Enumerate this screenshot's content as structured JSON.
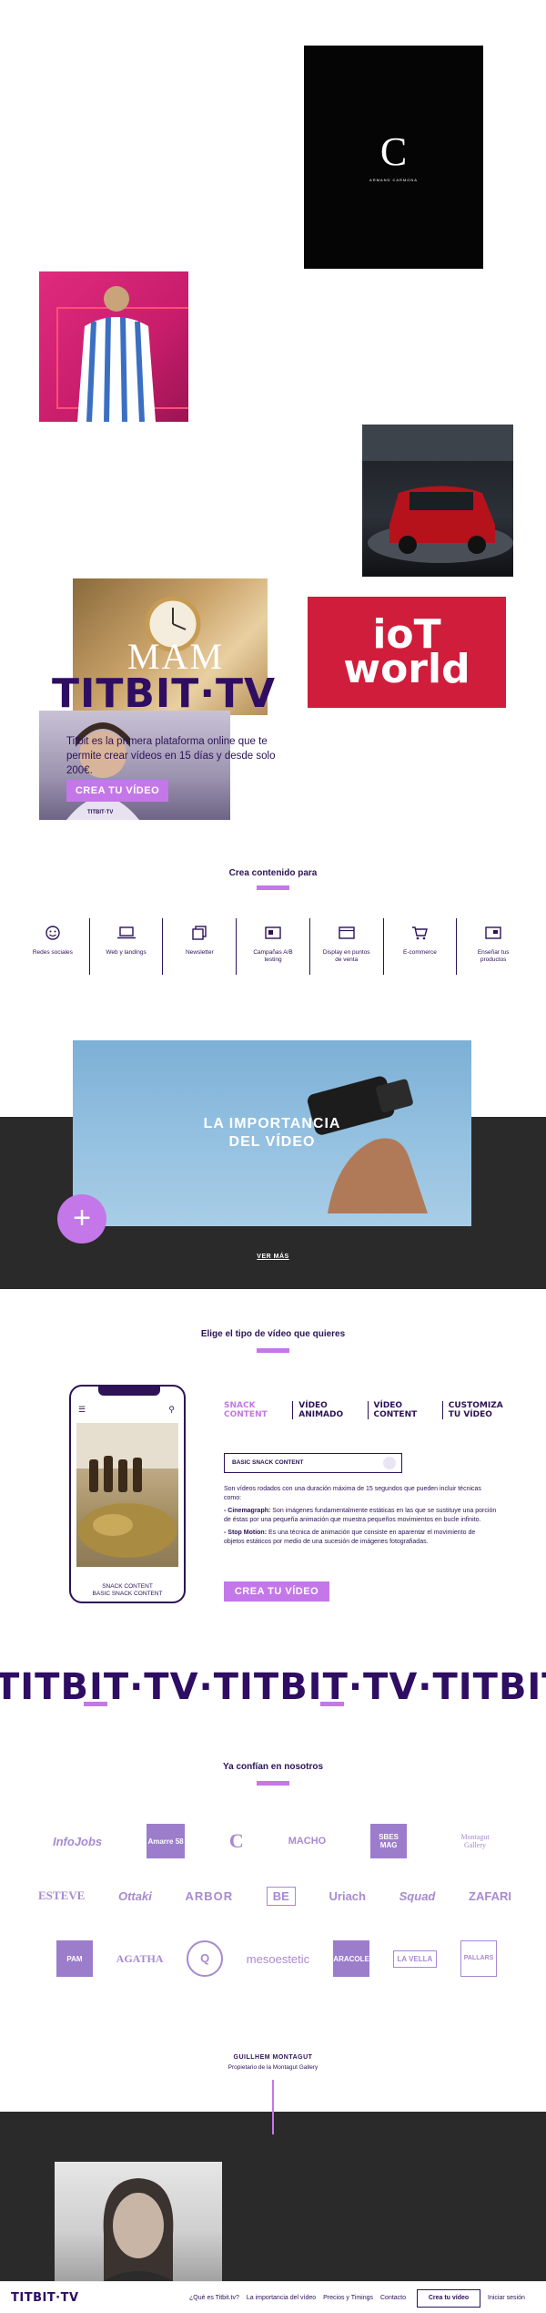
{
  "hero": {
    "tile_black_mark": "C",
    "tile_black_sub": "ARMAND CARMONA",
    "tile_iot": "ioT world",
    "tile_mam": "MAM",
    "brand": "TITBIT·TV",
    "text": "Titbit es la primera plataforma online que te permite crear vídeos en 15 días y desde solo 200€.",
    "cta": "CREA TU VÍDEO",
    "mini_brand": "TITBIT·TV"
  },
  "create_section": {
    "title": "Crea contenido para",
    "categories": [
      {
        "label": "Redes sociales",
        "icon": "smiley-icon"
      },
      {
        "label": "Web y landings",
        "icon": "laptop-icon"
      },
      {
        "label": "Newsletter",
        "icon": "newsletter-icon"
      },
      {
        "label": "Campañas A/B testing",
        "icon": "ab-test-icon"
      },
      {
        "label": "Display en puntos de venta",
        "icon": "display-icon"
      },
      {
        "label": "E-commerce",
        "icon": "cart-icon"
      },
      {
        "label": "Enseñar tus productos",
        "icon": "product-icon"
      }
    ]
  },
  "video_importance": {
    "title_line1": "LA IMPORTANCIA",
    "title_line2": "DEL VÍDEO",
    "plus": "+",
    "more": "VER MÁS"
  },
  "video_type": {
    "title": "Elige el tipo de vídeo que quieres",
    "tabs": [
      "SNACK CONTENT",
      "VÍDEO ANIMADO",
      "VÍDEO CONTENT",
      "CUSTOMIZA TU VÍDEO"
    ],
    "select_value": "BASIC SNACK CONTENT",
    "phone_caption_1": "SNACK CONTENT",
    "phone_caption_2": "BASIC SNACK CONTENT",
    "desc_intro": "Son vídeos rodados con una duración máxima de 15 segundos que pueden incluir técnicas como:",
    "desc_cine_label": "- Cinemagraph:",
    "desc_cine": "Son imágenes fundamentalmente estáticas en las que se sustituye una porción de éstas por una pequeña animación que muestra pequeños movimientos en bucle infinito.",
    "desc_stop_label": "- Stop Motion:",
    "desc_stop": "Es una técnica de animación que consiste en aparentar el movimiento de objetos estáticos por medio de una sucesión de imágenes fotografiadas.",
    "cta": "CREA TU VÍDEO"
  },
  "ticker": "TITBIT·TV·TITBIT·TV·TITBIT",
  "trust": {
    "title": "Ya confían en nosotros",
    "row1": [
      "InfoJobs",
      "Amarre 58",
      "C",
      "MACHO",
      "SBES MAG",
      "Montagut Gallery"
    ],
    "row2": [
      "ESTEVE",
      "Ottaki",
      "ARBOR",
      "BE",
      "Uriach",
      "Squad",
      "ZAFARI"
    ],
    "row3": [
      "PAM",
      "AGATHA",
      "Q",
      "mesoestetic",
      "CARACOLES",
      "LA VELLA",
      "PALLARS"
    ]
  },
  "testimonial": {
    "name": "GUILLHEM MONTAGUT",
    "role": "Propietario de la Montagut Gallery"
  },
  "footer": {
    "logo": "TITBIT·TV",
    "links": [
      "¿Qué es Titbit.tv?",
      "La importancia del vídeo",
      "Precios y Timings",
      "Contacto"
    ],
    "cta": "Crea tu vídeo",
    "login": "Iniciar sesión"
  }
}
